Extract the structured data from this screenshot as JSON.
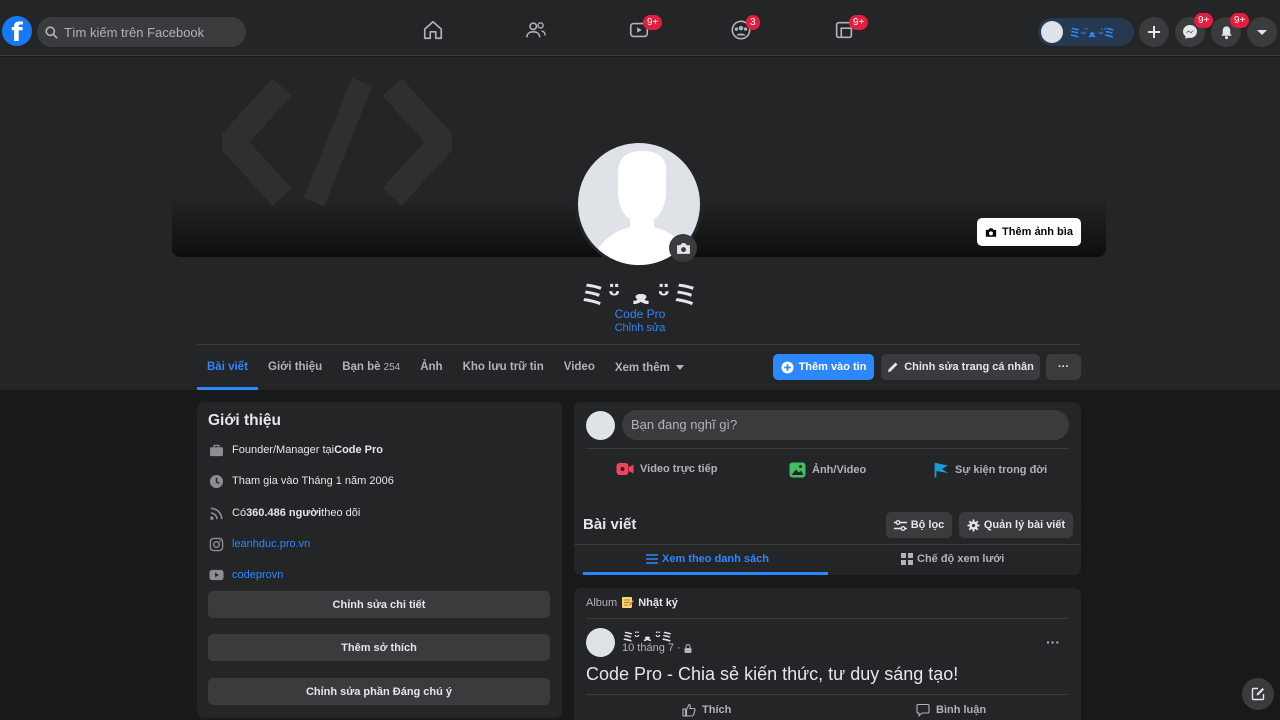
{
  "topbar": {
    "logo": "f",
    "search_placeholder": "Tìm kiếm trên Facebook",
    "nav": [
      {
        "name": "home",
        "badge": ""
      },
      {
        "name": "friends",
        "badge": ""
      },
      {
        "name": "watch",
        "badge": "9+"
      },
      {
        "name": "groups",
        "badge": "3"
      },
      {
        "name": "gaming",
        "badge": "9+"
      }
    ],
    "profile_chip_name": "ミᵕ̈ ﻌ ᵕ̈ミ",
    "messenger_badge": "9+",
    "notifications_badge": "9+"
  },
  "profile": {
    "name": "ミᵕ̈ ﻌ ᵕ̈ミ",
    "subtitle": "Code Pro",
    "edit_link": "Chỉnh sửa",
    "cover_button": "Thêm ảnh bìa"
  },
  "tabs": [
    {
      "label": "Bài viết",
      "count": ""
    },
    {
      "label": "Giới thiệu",
      "count": ""
    },
    {
      "label": "Bạn bè",
      "count": "254"
    },
    {
      "label": "Ảnh",
      "count": ""
    },
    {
      "label": "Kho lưu trữ tin",
      "count": ""
    },
    {
      "label": "Video",
      "count": ""
    },
    {
      "label": "Xem thêm",
      "count": ""
    }
  ],
  "actions": {
    "add_story": "Thêm vào tin",
    "edit_profile": "Chỉnh sửa trang cá nhân",
    "more": "···"
  },
  "intro": {
    "title": "Giới thiệu",
    "work_prefix": "Founder/Manager tại ",
    "work_company": "Code Pro",
    "joined": "Tham gia vào Tháng 1 năm 2006",
    "followers_prefix": "Có ",
    "followers_count": "360.486 người",
    "followers_suffix": " theo dõi",
    "instagram": "leanhduc.pro.vn",
    "youtube": "codeprovn",
    "btn_edit_details": "Chỉnh sửa chi tiết",
    "btn_add_hobbies": "Thêm sở thích",
    "btn_edit_featured": "Chỉnh sửa phần Đáng chú ý"
  },
  "composer": {
    "placeholder": "Bạn đang nghĩ gì?",
    "live": "Video trực tiếp",
    "photo": "Ảnh/Video",
    "event": "Sự kiện trong đời"
  },
  "posts": {
    "title": "Bài viết",
    "filter": "Bộ lọc",
    "manage": "Quản lý bài viết",
    "list_view": "Xem theo danh sách",
    "grid_view": "Chế độ xem lưới"
  },
  "post": {
    "album_label": "Album",
    "album_name": "Nhật ký",
    "author": "ミᵕ̈ ﻌ ᵕ̈ミ",
    "date": "10 tháng 7 ·",
    "text": "Code Pro - Chia sẻ kiến thức, tư duy sáng tạo!",
    "like": "Thích",
    "comment": "Bình luận",
    "more": "···"
  },
  "colors": {
    "accent": "#2d88ff",
    "badge": "#e41e3f",
    "surface": "#242526",
    "background": "#18191a"
  }
}
